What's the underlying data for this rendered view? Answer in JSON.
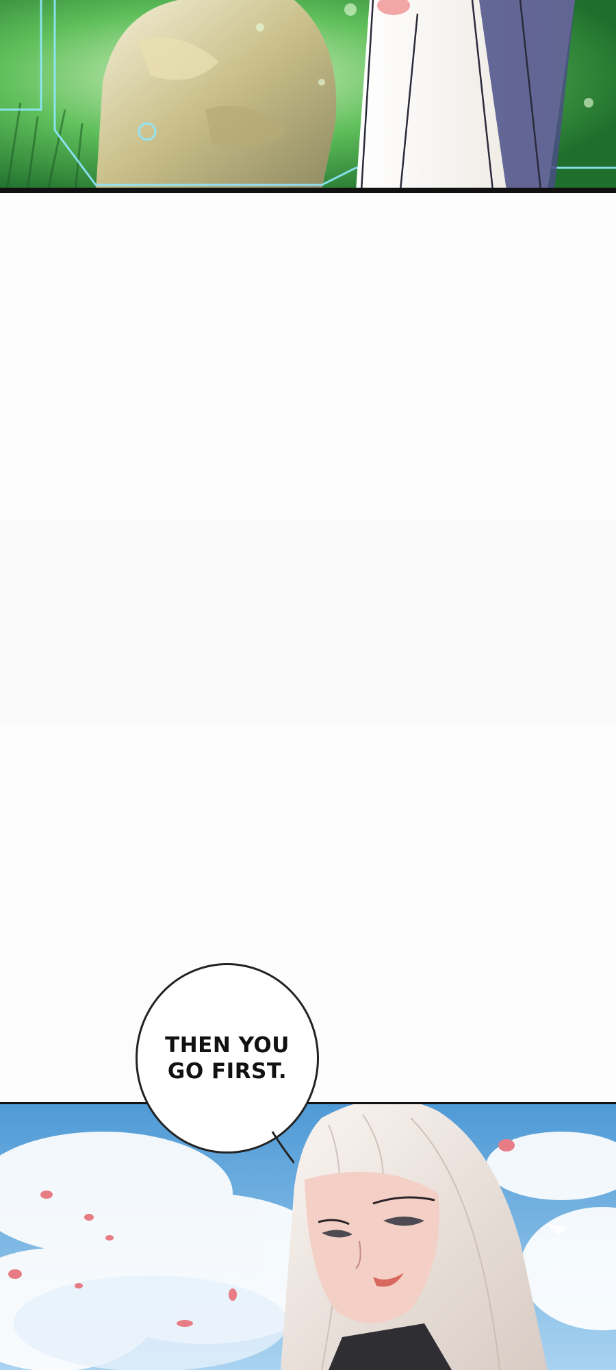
{
  "comic": {
    "speech_bubble": {
      "text": "THEN YOU\nGO FIRST."
    },
    "colors": {
      "gutter": "#fdfcfc",
      "panel_border": "#111111",
      "top_panel_grass": "#2f8a3a",
      "sky": "#6aaee0",
      "hair": "#efe6e2"
    }
  }
}
